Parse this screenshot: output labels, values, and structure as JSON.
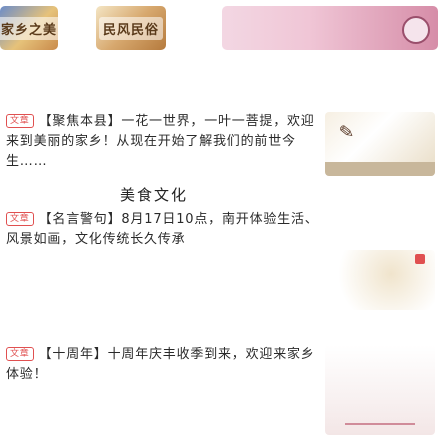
{
  "tabs": [
    {
      "label": "家乡之美"
    },
    {
      "label": "民风民俗"
    },
    {
      "label": ""
    }
  ],
  "posts": [
    {
      "tag": "文章",
      "text": "【聚焦本县】一花一世界，一叶一菩提，欢迎来到美丽的家乡！从现在开始了解我们的前世今生……"
    },
    {
      "tag": "文章",
      "text": "【名言警句】8月17日10点，南开体验生活、风景如画，文化传统长久传承"
    },
    {
      "tag": "文章",
      "text": "【十周年】十周年庆丰收季到来，欢迎来家乡体验！"
    }
  ],
  "section_heading": "美食文化"
}
